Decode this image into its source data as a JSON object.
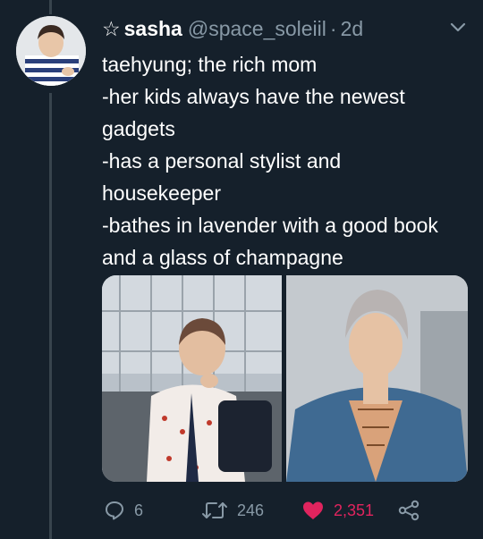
{
  "tweet": {
    "display_name": "sasha",
    "handle": "@space_soleiil",
    "separator": "·",
    "time": "2d",
    "text_lines": [
      "taehyung; the rich mom",
      "-her kids always have the newest",
      "gadgets",
      "-has a personal stylist and",
      "housekeeper",
      "-bathes in lavender with a good book",
      "and a glass of champagne"
    ]
  },
  "actions": {
    "reply_count": "6",
    "retweet_count": "246",
    "like_count": "2,351"
  },
  "colors": {
    "background": "#15202b",
    "secondary_text": "#8899a6",
    "like": "#e0245e",
    "thread_line": "#38444d"
  },
  "icons": [
    "star-icon",
    "chevron-down-icon",
    "reply-icon",
    "retweet-icon",
    "heart-icon",
    "share-icon"
  ]
}
